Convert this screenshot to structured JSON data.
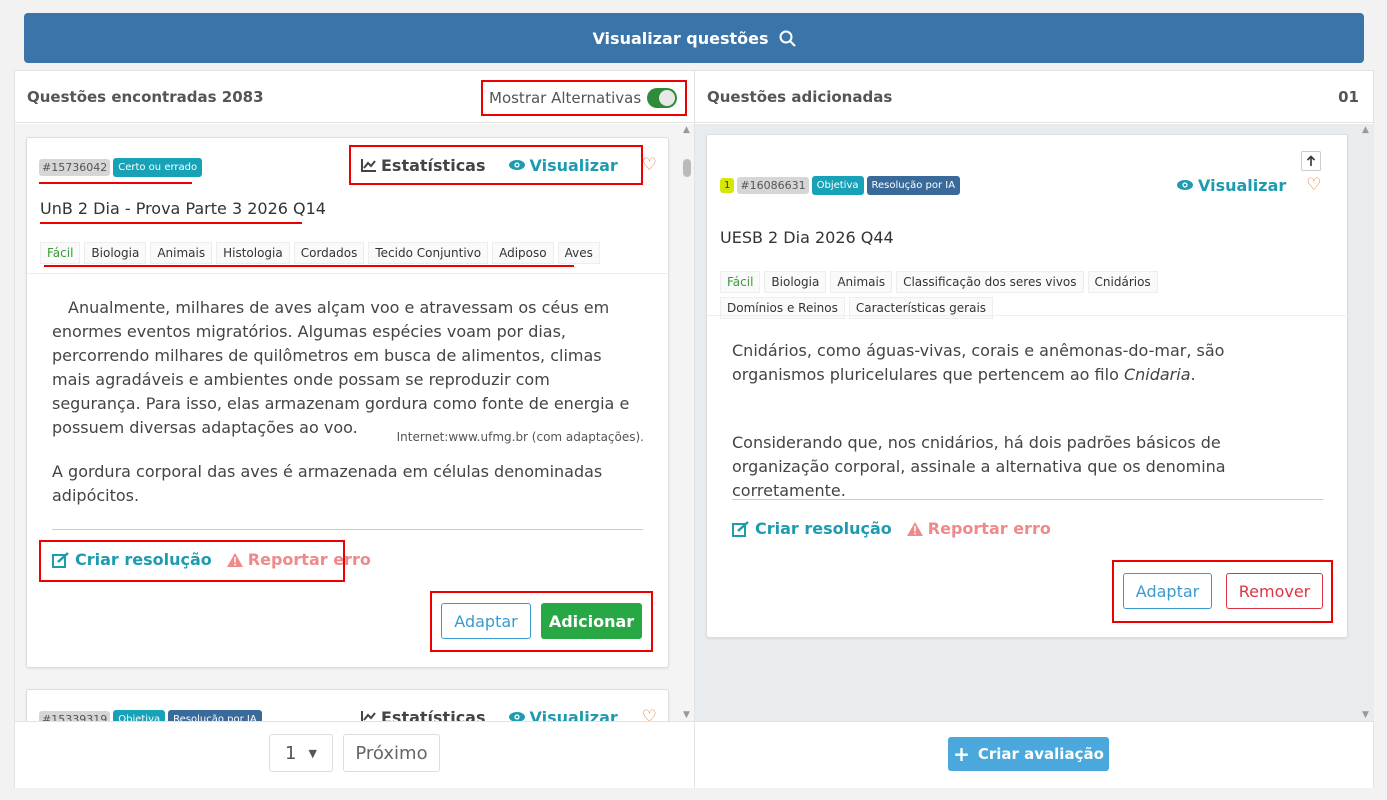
{
  "topbar": {
    "label": "Visualizar questões"
  },
  "left": {
    "title": "Questões encontradas 2083",
    "toggle_label": "Mostrar Alternativas",
    "card1": {
      "id": "#15736042",
      "type": "Certo ou errado",
      "stats": "Estatísticas",
      "view": "Visualizar",
      "title": "UnB 2 Dia - Prova Parte 3 2026 Q14",
      "subjects": [
        "Fácil",
        "Biologia",
        "Animais",
        "Histologia",
        "Cordados",
        "Tecido Conjuntivo",
        "Adiposo",
        "Aves"
      ],
      "paragraph": "Anualmente, milhares de aves alçam voo e atravessam os céus em enormes eventos migratórios. Algumas espécies voam por dias, percorrendo milhares de quilômetros em busca de alimentos, climas mais agradáveis e ambientes onde possam se reproduzir com segurança. Para isso, elas armazenam gordura como fonte de energia e possuem diversas adaptações ao voo.",
      "source": "Internet:www.ufmg.br (com adaptações).",
      "statement": "A gordura corporal das aves é armazenada em células denominadas adipócitos.",
      "create_resolution": "Criar resolução",
      "report_error": "Reportar erro",
      "adapt": "Adaptar",
      "add": "Adicionar"
    },
    "card2": {
      "id": "#15339319",
      "type": "Objetiva",
      "ai": "Resolução por IA",
      "stats": "Estatísticas",
      "view": "Visualizar"
    },
    "pagination": {
      "page": "1",
      "next": "Próximo"
    }
  },
  "right": {
    "title": "Questões adicionadas",
    "count": "01",
    "card": {
      "order": "1",
      "id": "#16086631",
      "type": "Objetiva",
      "ai": "Resolução por IA",
      "view": "Visualizar",
      "title": "UESB 2 Dia 2026 Q44",
      "subjects": [
        "Fácil",
        "Biologia",
        "Animais",
        "Classificação dos seres vivos",
        "Cnidários",
        "Domínios e Reinos",
        "Características gerais"
      ],
      "p1_before": "Cnidários, como águas-vivas, corais e anêmonas-do-mar, são organismos pluricelulares que pertencem ao filo ",
      "p1_italic": "Cnidaria",
      "p1_after": ".",
      "p2": "Considerando que, nos cnidários, há dois padrões básicos de organização corporal, assinale a alternativa que os denomina corretamente.",
      "create_resolution": "Criar resolução",
      "report_error": "Reportar erro",
      "adapt": "Adaptar",
      "remove": "Remover"
    },
    "create_evaluation": "Criar avaliação"
  }
}
